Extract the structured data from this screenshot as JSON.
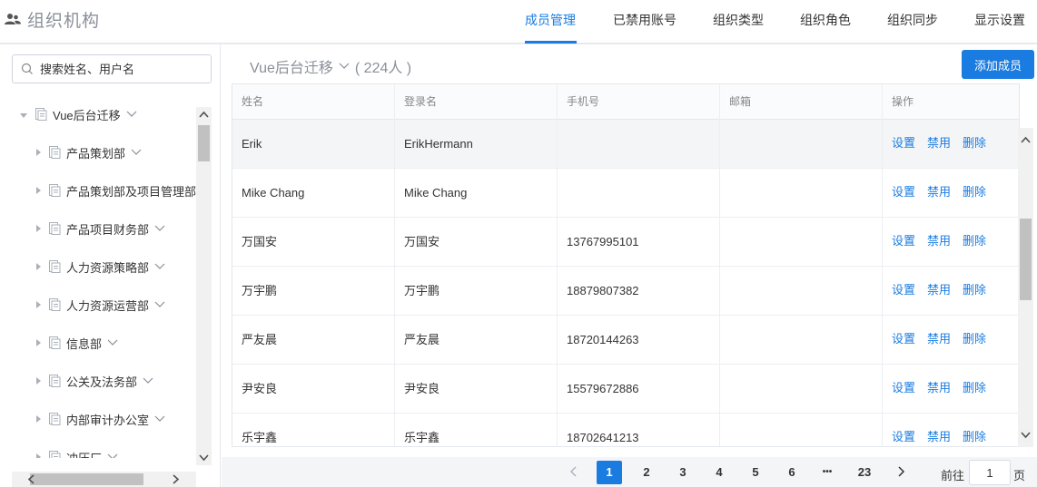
{
  "brand": {
    "icon": "users-icon",
    "title": "组织机构"
  },
  "nav": {
    "tabs": [
      {
        "label": "成员管理",
        "active": true
      },
      {
        "label": "已禁用账号",
        "active": false
      },
      {
        "label": "组织类型",
        "active": false
      },
      {
        "label": "组织角色",
        "active": false
      },
      {
        "label": "组织同步",
        "active": false
      },
      {
        "label": "显示设置",
        "active": false
      }
    ]
  },
  "sidebar": {
    "search_placeholder": "搜索姓名、用户名",
    "root": {
      "label": "Vue后台迁移"
    },
    "items": [
      {
        "label": "产品策划部"
      },
      {
        "label": "产品策划部及项目管理部"
      },
      {
        "label": "产品项目财务部"
      },
      {
        "label": "人力资源策略部"
      },
      {
        "label": "人力资源运营部"
      },
      {
        "label": "信息部"
      },
      {
        "label": "公关及法务部"
      },
      {
        "label": "内部审计办公室"
      },
      {
        "label": "冲压厂"
      }
    ]
  },
  "main": {
    "org_name": "Vue后台迁移",
    "member_count": "( 224人 )",
    "add_button": "添加成员",
    "columns": [
      "姓名",
      "登录名",
      "手机号",
      "邮箱",
      "操作"
    ],
    "actions": [
      "设置",
      "禁用",
      "删除"
    ],
    "rows": [
      {
        "name": "Erik",
        "login": "ErikHermann",
        "phone": "",
        "email": ""
      },
      {
        "name": "Mike Chang",
        "login": "Mike Chang",
        "phone": "",
        "email": ""
      },
      {
        "name": "万国安",
        "login": "万国安",
        "phone": "13767995101",
        "email": ""
      },
      {
        "name": "万宇鹏",
        "login": "万宇鹏",
        "phone": "18879807382",
        "email": ""
      },
      {
        "name": "严友晨",
        "login": "严友晨",
        "phone": "18720144263",
        "email": ""
      },
      {
        "name": "尹安良",
        "login": "尹安良",
        "phone": "15579672886",
        "email": ""
      },
      {
        "name": "乐宇鑫",
        "login": "乐宇鑫",
        "phone": "18702641213",
        "email": ""
      }
    ]
  },
  "pagination": {
    "pages": [
      "1",
      "2",
      "3",
      "4",
      "5",
      "6",
      "•••",
      "23"
    ],
    "current": "1",
    "goto_prefix": "前往",
    "goto_value": "1",
    "goto_suffix": "页"
  },
  "colors": {
    "accent": "#1a7ce0",
    "muted": "#8a9099"
  }
}
